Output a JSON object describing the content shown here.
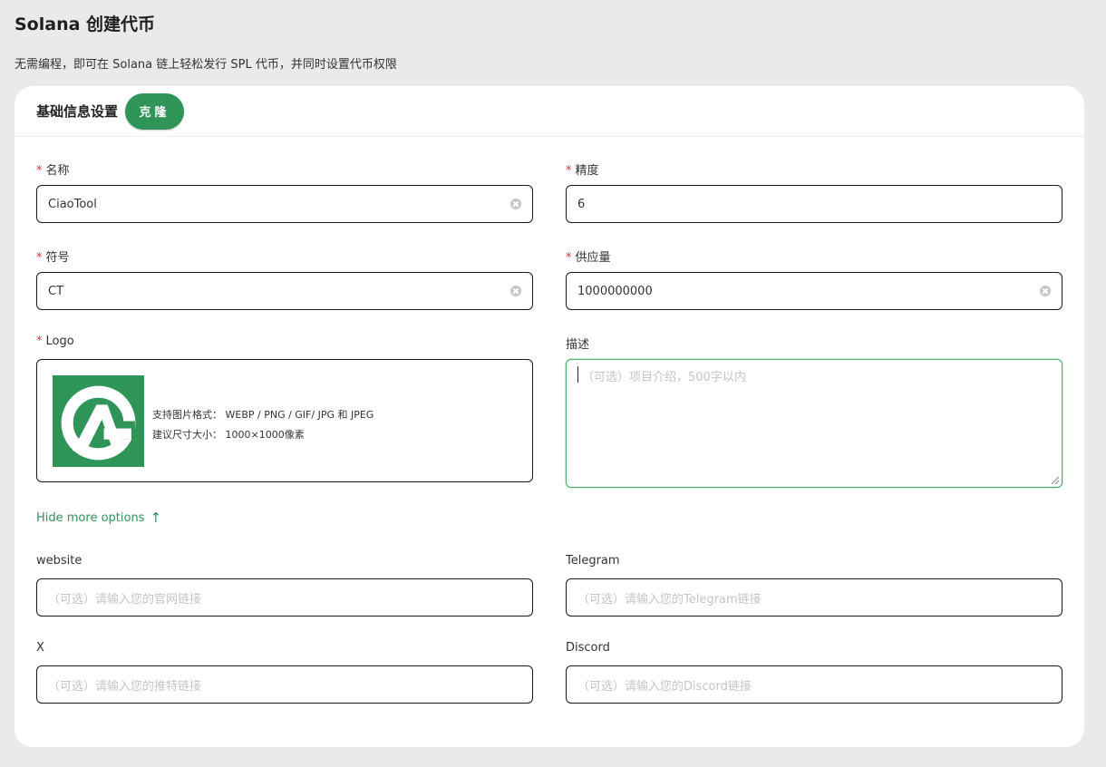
{
  "page": {
    "title": "Solana 创建代币",
    "subtitle": "无需编程，即可在 Solana 链上轻松发行 SPL 代币，并同时设置代币权限"
  },
  "card": {
    "title": "基础信息设置",
    "clone_label": "克隆"
  },
  "fields": {
    "name": {
      "label": "名称",
      "value": "CiaoTool"
    },
    "decimals": {
      "label": "精度",
      "value": "6"
    },
    "symbol": {
      "label": "符号",
      "value": "CT"
    },
    "supply": {
      "label": "供应量",
      "value": "1000000000"
    },
    "logo": {
      "label": "Logo",
      "formats": "支持图片格式： WEBP / PNG / GIF/ JPG 和 JPEG",
      "size": "建议尺寸大小： 1000×1000像素"
    },
    "description": {
      "label": "描述",
      "placeholder": "（可选）项目介绍，500字以内"
    }
  },
  "more_options": {
    "toggle_label": "Hide more options"
  },
  "social": {
    "website": {
      "label": "website",
      "placeholder": "（可选）请输入您的官网链接"
    },
    "telegram": {
      "label": "Telegram",
      "placeholder": "（可选）请输入您的Telegram链接"
    },
    "x": {
      "label": "X",
      "placeholder": "（可选）请输入您的推特链接"
    },
    "discord": {
      "label": "Discord",
      "placeholder": "（可选）请输入您的Discord链接"
    }
  },
  "required_mark": "*",
  "colors": {
    "accent": "#2e9457",
    "required": "#d9363e",
    "background": "#e9eaec"
  },
  "icons": {
    "clear": "clear-icon",
    "arrow": "arrow-up-icon",
    "logo": "ciaotool-logo"
  }
}
